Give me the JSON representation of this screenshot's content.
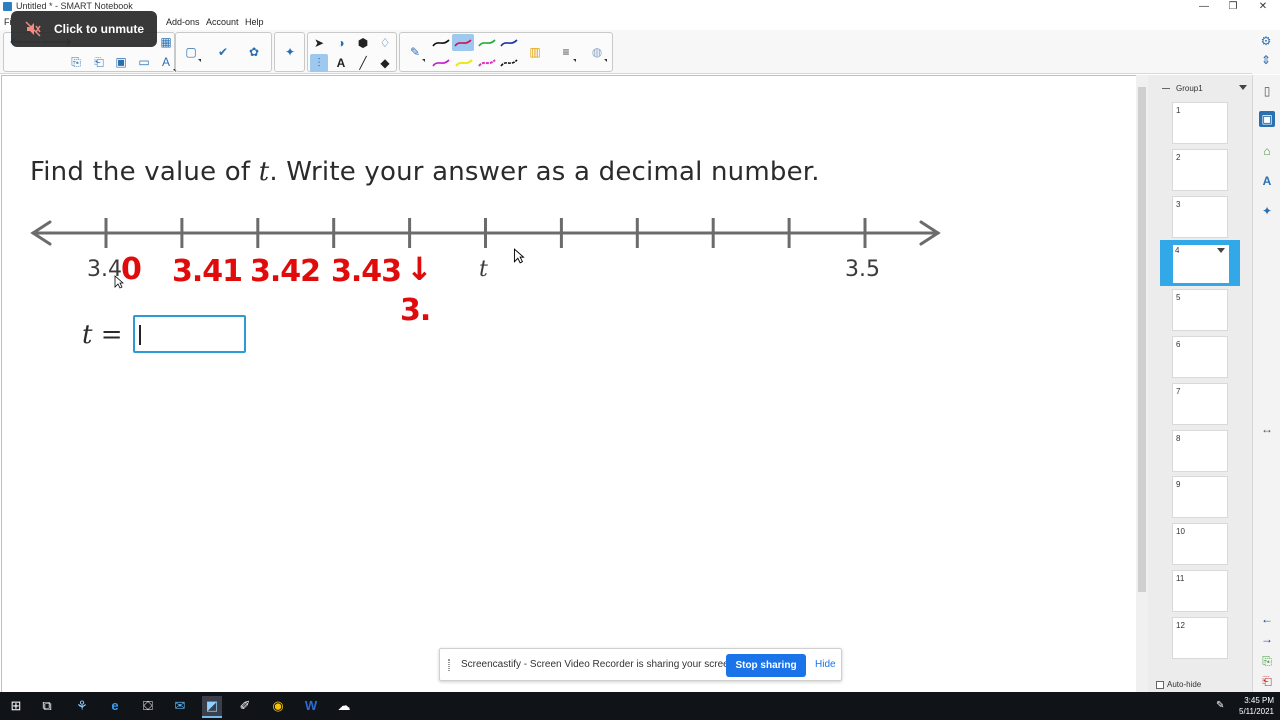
{
  "window": {
    "title": "Untitled * - SMART Notebook",
    "minimize_glyph": "—",
    "maximize_glyph": "❐",
    "close_glyph": "✕"
  },
  "menu": {
    "file_label": "Fi",
    "addons_label": "Add-ons",
    "account_label": "Account",
    "help_label": "Help"
  },
  "mute_toast": {
    "label": "Click to unmute"
  },
  "question": {
    "prefix": "Find the value of ",
    "variable": "t",
    "suffix": ". Write your answer as a decimal number."
  },
  "number_line": {
    "left_label": "3.4",
    "right_label": "3.5",
    "variable_label": "t"
  },
  "handwriting": {
    "zero": "0",
    "label_341": "3.41",
    "label_342": "3.42",
    "label_343": "3.43",
    "arrow": "↓",
    "partial": "3."
  },
  "answer": {
    "label_var": "t",
    "label_eq": " = ",
    "value": ""
  },
  "side_panel": {
    "group_title": "Group1",
    "pages": [
      "1",
      "2",
      "3",
      "4",
      "5",
      "6",
      "7",
      "8",
      "9",
      "10",
      "11",
      "12"
    ],
    "selected_page": "4",
    "autohide_label": "Auto-hide"
  },
  "share_bar": {
    "message": "Screencastify - Screen Video Recorder is sharing your screen.",
    "stop_label": "Stop sharing",
    "hide_label": "Hide"
  },
  "taskbar": {
    "time": "3:45 PM",
    "date": "5/11/2021"
  },
  "colors": {
    "accent": "#2b9ad8",
    "handwriting": "#e00b0b",
    "selected_thumb": "#33a8e8",
    "stop_button": "#1a73e8"
  }
}
